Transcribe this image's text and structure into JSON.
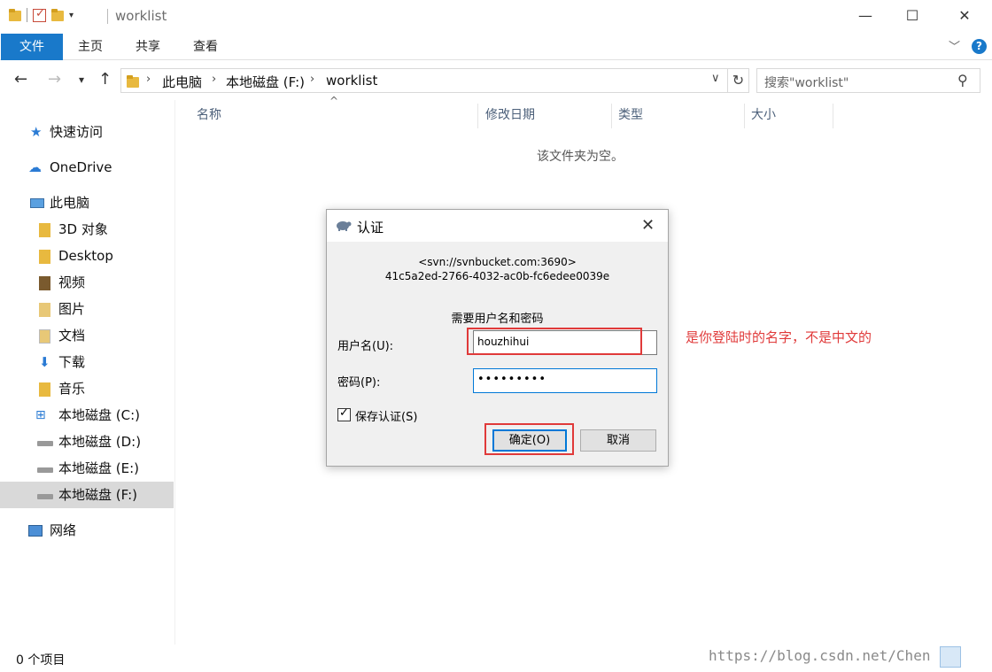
{
  "window": {
    "title": "worklist"
  },
  "ribbon": {
    "tabs": [
      "文件",
      "主页",
      "共享",
      "查看"
    ],
    "help_glyph": "?"
  },
  "address": {
    "crumbs": [
      "此电脑",
      "本地磁盘 (F:)",
      "worklist"
    ],
    "search_placeholder": "搜索\"worklist\""
  },
  "sidebar": {
    "items": [
      {
        "label": "快速访问",
        "icon": "star-icon"
      },
      {
        "label": "OneDrive",
        "icon": "cloud-icon"
      },
      {
        "label": "此电脑",
        "icon": "computer-icon"
      },
      {
        "label": "3D 对象",
        "icon": "folder-3d-icon"
      },
      {
        "label": "Desktop",
        "icon": "folder-desktop-icon"
      },
      {
        "label": "视频",
        "icon": "folder-video-icon"
      },
      {
        "label": "图片",
        "icon": "folder-pictures-icon"
      },
      {
        "label": "文档",
        "icon": "folder-documents-icon"
      },
      {
        "label": "下载",
        "icon": "folder-downloads-icon"
      },
      {
        "label": "音乐",
        "icon": "folder-music-icon"
      },
      {
        "label": "本地磁盘 (C:)",
        "icon": "windows-drive-icon"
      },
      {
        "label": "本地磁盘 (D:)",
        "icon": "drive-icon"
      },
      {
        "label": "本地磁盘 (E:)",
        "icon": "drive-icon"
      },
      {
        "label": "本地磁盘 (F:)",
        "icon": "drive-icon",
        "selected": true
      },
      {
        "label": "网络",
        "icon": "network-icon"
      }
    ]
  },
  "content": {
    "columns": [
      "名称",
      "修改日期",
      "类型",
      "大小"
    ],
    "empty_message": "该文件夹为空。"
  },
  "status": {
    "item_count": "0 个项目",
    "watermark": "https://blog.csdn.net/Chen"
  },
  "dialog": {
    "title": "认证",
    "server_line1": "<svn://svnbucket.com:3690>",
    "server_line2": "41c5a2ed-2766-4032-ac0b-fc6edee0039e",
    "prompt": "需要用户名和密码",
    "username_label": "用户名(U):",
    "username_value": "houzhihui",
    "password_label": "密码(P):",
    "password_value": "•••••••••",
    "save_label": "保存认证(S)",
    "save_checked": true,
    "ok_label": "确定(O)",
    "cancel_label": "取消"
  },
  "annotation": {
    "text": "是你登陆时的名字，不是中文的",
    "color": "#e03a3a"
  }
}
